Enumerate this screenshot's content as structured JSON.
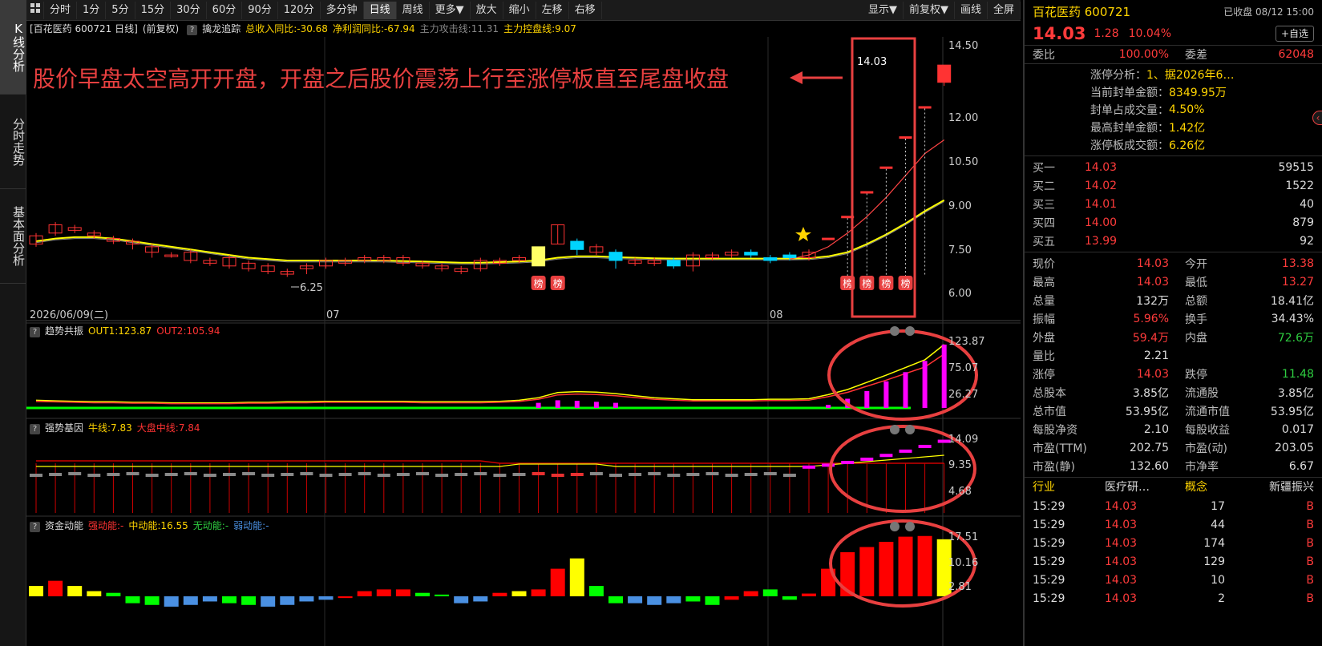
{
  "sidebar": {
    "tabs": [
      {
        "label": "K线分析"
      },
      {
        "label": "分时走势"
      },
      {
        "label": "基本面分析"
      }
    ]
  },
  "toolbar": {
    "left_items": [
      "分时",
      "1分",
      "5分",
      "15分",
      "30分",
      "60分",
      "90分",
      "120分",
      "多分钟",
      "日线",
      "周线",
      "更多▼",
      "放大",
      "缩小",
      "左移",
      "右移"
    ],
    "active": "日线",
    "right_items": [
      "显示▼",
      "前复权▼",
      "画线",
      "全屏"
    ]
  },
  "main_chart": {
    "info": {
      "title": "[百花医药 600721 日线]",
      "adjust": "(前复权)",
      "indicator_name": "擒龙追踪",
      "rev_yoy": "总收入同比:-30.68",
      "profit_yoy": "净利润同比:-67.94",
      "attack_line": "主力攻击线:11.31",
      "control_line": "主力控盘线:9.07"
    },
    "annotation": "股价早盘太空高开开盘，开盘之后股价震荡上行至涨停板直至尾盘收盘",
    "price_labels": [
      "14.50",
      "12.00",
      "10.50",
      "9.00",
      "7.50",
      "6.00"
    ],
    "high_label": "14.03",
    "low_label": "6.25",
    "date_labels": [
      "2026/06/09(二)",
      "07",
      "08"
    ],
    "badge": "榜",
    "colors": {
      "up": "#ff3333",
      "down": "#00d4ff",
      "ma_yellow": "#ffff00",
      "ma_gray": "#888888",
      "ma_red": "#ff4444",
      "highlight": "#e84040"
    }
  },
  "panel_trend": {
    "name": "趋势共振",
    "out1": "OUT1:123.87",
    "out2": "OUT2:105.94",
    "labels": [
      "123.87",
      "75.07",
      "26.27"
    ]
  },
  "panel_strong": {
    "name": "强势基因",
    "bull": "牛线:7.83",
    "market": "大盘中线:7.84",
    "labels": [
      "14.09",
      "9.35",
      "4.68"
    ]
  },
  "panel_fund": {
    "name": "资金动能",
    "strong": "强动能:-",
    "mid": "中动能:16.55",
    "none": "无动能:-",
    "weak": "弱动能:-",
    "labels": [
      "17.51",
      "10.16",
      "2.81"
    ]
  },
  "chart_data": {
    "type": "candlestick",
    "candles": [
      [
        7.5,
        7.8,
        7.4,
        7.9
      ],
      [
        7.9,
        8.2,
        7.8,
        8.3
      ],
      [
        8.0,
        8.1,
        7.9,
        8.2
      ],
      [
        7.8,
        7.9,
        7.7,
        8.0
      ],
      [
        7.6,
        7.7,
        7.5,
        7.8
      ],
      [
        7.5,
        7.6,
        7.3,
        7.7
      ],
      [
        7.2,
        7.4,
        7.0,
        7.5
      ],
      [
        7.1,
        7.1,
        7.0,
        7.2
      ],
      [
        6.9,
        7.2,
        6.8,
        7.3
      ],
      [
        6.8,
        6.9,
        6.7,
        7.0
      ],
      [
        6.7,
        7.0,
        6.6,
        7.1
      ],
      [
        6.6,
        6.8,
        6.5,
        6.9
      ],
      [
        6.5,
        6.7,
        6.4,
        6.8
      ],
      [
        6.4,
        6.5,
        6.3,
        6.6
      ],
      [
        6.6,
        6.7,
        6.4,
        6.8
      ],
      [
        6.7,
        6.9,
        6.6,
        7.0
      ],
      [
        6.8,
        6.9,
        6.7,
        7.0
      ],
      [
        6.9,
        7.0,
        6.8,
        7.1
      ],
      [
        6.9,
        7.0,
        6.8,
        7.1
      ],
      [
        6.8,
        7.0,
        6.7,
        7.1
      ],
      [
        6.7,
        6.8,
        6.6,
        6.9
      ],
      [
        6.6,
        6.7,
        6.5,
        6.8
      ],
      [
        6.5,
        6.6,
        6.4,
        6.7
      ],
      [
        6.6,
        6.9,
        6.5,
        7.0
      ],
      [
        6.8,
        6.9,
        6.7,
        7.0
      ],
      [
        6.9,
        7.0,
        6.8,
        7.1
      ],
      [
        6.7,
        7.4,
        6.7,
        7.4
      ],
      [
        7.5,
        8.2,
        7.5,
        8.2
      ],
      [
        7.6,
        7.3,
        7.1,
        7.7
      ],
      [
        7.2,
        7.4,
        7.1,
        7.5
      ],
      [
        7.2,
        6.9,
        6.6,
        7.3
      ],
      [
        6.8,
        6.9,
        6.7,
        7.0
      ],
      [
        6.8,
        6.9,
        6.7,
        7.0
      ],
      [
        6.9,
        6.7,
        6.6,
        7.0
      ],
      [
        6.7,
        7.1,
        6.5,
        7.2
      ],
      [
        7.0,
        7.1,
        6.9,
        7.2
      ],
      [
        7.1,
        7.2,
        7.0,
        7.3
      ],
      [
        7.2,
        7.1,
        7.0,
        7.3
      ],
      [
        7.0,
        6.9,
        6.8,
        7.1
      ],
      [
        7.1,
        7.0,
        6.9,
        7.2
      ],
      [
        7.0,
        7.2,
        6.9,
        7.3
      ],
      [
        7.7,
        7.7,
        7.7,
        7.7
      ],
      [
        8.5,
        8.5,
        8.5,
        8.5
      ],
      [
        9.4,
        9.4,
        9.4,
        9.4
      ],
      [
        10.3,
        10.3,
        10.3,
        10.3
      ],
      [
        11.4,
        11.4,
        11.4,
        11.4
      ],
      [
        12.5,
        12.5,
        12.5,
        12.5
      ],
      [
        13.4,
        14.03,
        13.27,
        14.03
      ]
    ],
    "ylim": [
      5.7,
      15.0
    ],
    "ma_yellow": [
      7.6,
      7.7,
      7.75,
      7.75,
      7.7,
      7.6,
      7.5,
      7.4,
      7.3,
      7.2,
      7.1,
      7.0,
      6.95,
      6.9,
      6.9,
      6.9,
      6.9,
      6.9,
      6.9,
      6.88,
      6.86,
      6.84,
      6.82,
      6.82,
      6.84,
      6.86,
      6.9,
      7.0,
      7.05,
      7.05,
      7.02,
      7.0,
      6.98,
      6.97,
      6.97,
      6.97,
      6.97,
      6.97,
      6.97,
      6.97,
      6.98,
      7.05,
      7.2,
      7.5,
      7.85,
      8.25,
      8.7,
      9.1
    ],
    "ma_red": [
      null,
      null,
      null,
      null,
      null,
      null,
      null,
      null,
      null,
      null,
      null,
      null,
      null,
      null,
      null,
      null,
      null,
      null,
      null,
      null,
      null,
      null,
      null,
      null,
      null,
      null,
      null,
      null,
      null,
      null,
      null,
      null,
      null,
      null,
      null,
      null,
      null,
      null,
      null,
      6.95,
      7.1,
      7.4,
      7.9,
      8.5,
      9.2,
      10.0,
      10.8,
      11.3
    ],
    "trend_out1": [
      15,
      14,
      13,
      12,
      12,
      11,
      11,
      10,
      10,
      10,
      10,
      11,
      11,
      12,
      12,
      13,
      13,
      13,
      13,
      13,
      12,
      12,
      12,
      12,
      13,
      15,
      20,
      30,
      32,
      31,
      28,
      24,
      20,
      18,
      16,
      16,
      16,
      16,
      17,
      17,
      18,
      26,
      36,
      50,
      64,
      79,
      94,
      123.87
    ],
    "trend_bars": [
      0,
      0,
      0,
      0,
      0,
      0,
      0,
      0,
      0,
      0,
      0,
      0,
      0,
      0,
      0,
      0,
      0,
      0,
      0,
      0,
      0,
      0,
      0,
      0,
      0,
      0,
      10,
      15,
      14,
      12,
      10,
      0,
      0,
      0,
      0,
      0,
      0,
      0,
      0,
      0,
      0,
      6,
      18,
      33,
      52,
      70,
      92,
      123.87
    ],
    "fund_bars": [
      3,
      4.5,
      3,
      1.5,
      1,
      -2,
      -2.5,
      -3,
      -2.5,
      -1.5,
      -2,
      -2.5,
      -3,
      -2.5,
      -1.5,
      -1,
      -0.5,
      1.5,
      2,
      2,
      1,
      0.5,
      -2,
      -1.5,
      1,
      1.5,
      2,
      8,
      11,
      3,
      -2,
      -2,
      -2.5,
      -2,
      -1.5,
      -2.5,
      -1,
      1.5,
      2,
      -1,
      0.8,
      8,
      12.8,
      14.3,
      15.8,
      17.3,
      17.5,
      16.55
    ],
    "fund_colors": [
      "y",
      "r",
      "y",
      "y",
      "g",
      "g",
      "g",
      "b",
      "b",
      "b",
      "g",
      "g",
      "b",
      "b",
      "b",
      "b",
      "r",
      "r",
      "r",
      "r",
      "g",
      "g",
      "b",
      "b",
      "r",
      "y",
      "r",
      "r",
      "y",
      "g",
      "g",
      "b",
      "b",
      "b",
      "g",
      "g",
      "r",
      "r",
      "g",
      "g",
      "r",
      "r",
      "r",
      "r",
      "r",
      "r",
      "r",
      "y"
    ]
  },
  "right_panel": {
    "name": "百花医药 600721",
    "status": "已收盘 08/12 15:00",
    "price": "14.03",
    "change": "1.28",
    "pct": "10.04%",
    "watch": "+自选",
    "wb_label": "委比",
    "wb_val": "100.00%",
    "wc_label": "委差",
    "wc_val": "62048",
    "limit_info": [
      {
        "label": "涨停分析：",
        "val": "1、据2026年6…"
      },
      {
        "label": "当前封单金额：",
        "val": "8349.95万"
      },
      {
        "label": "封单占成交量：",
        "val": "4.50%"
      },
      {
        "label": "最高封单金额：",
        "val": "1.42亿"
      },
      {
        "label": "涨停板成交额：",
        "val": "6.26亿"
      }
    ],
    "bids": [
      {
        "label": "买一",
        "price": "14.03",
        "vol": "59515"
      },
      {
        "label": "买二",
        "price": "14.02",
        "vol": "1522"
      },
      {
        "label": "买三",
        "price": "14.01",
        "vol": "40"
      },
      {
        "label": "买四",
        "price": "14.00",
        "vol": "879"
      },
      {
        "label": "买五",
        "price": "13.99",
        "vol": "92"
      }
    ],
    "quote": [
      {
        "l1": "现价",
        "v1": "14.03",
        "c1": "red",
        "l2": "今开",
        "v2": "13.38",
        "c2": "red"
      },
      {
        "l1": "最高",
        "v1": "14.03",
        "c1": "red",
        "l2": "最低",
        "v2": "13.27",
        "c2": "red"
      },
      {
        "l1": "总量",
        "v1": "132万",
        "c1": "white",
        "l2": "总额",
        "v2": "18.41亿",
        "c2": "white"
      },
      {
        "l1": "振幅",
        "v1": "5.96%",
        "c1": "red",
        "l2": "换手",
        "v2": "34.43%",
        "c2": "white"
      },
      {
        "l1": "外盘",
        "v1": "59.4万",
        "c1": "red",
        "l2": "内盘",
        "v2": "72.6万",
        "c2": "green"
      },
      {
        "l1": "量比",
        "v1": "2.21",
        "c1": "white",
        "l2": "",
        "v2": "",
        "c2": "white"
      },
      {
        "l1": "涨停",
        "v1": "14.03",
        "c1": "red",
        "l2": "跌停",
        "v2": "11.48",
        "c2": "green"
      },
      {
        "l1": "总股本",
        "v1": "3.85亿",
        "c1": "white",
        "l2": "流通股",
        "v2": "3.85亿",
        "c2": "white"
      },
      {
        "l1": "总市值",
        "v1": "53.95亿",
        "c1": "white",
        "l2": "流通市值",
        "v2": "53.95亿",
        "c2": "white"
      },
      {
        "l1": "每股净资",
        "v1": "2.10",
        "c1": "white",
        "l2": "每股收益",
        "v2": "0.017",
        "c2": "white"
      },
      {
        "l1": "市盈(TTM)",
        "v1": "202.75",
        "c1": "white",
        "l2": "市盈(动)",
        "v2": "203.05",
        "c2": "white"
      },
      {
        "l1": "市盈(静)",
        "v1": "132.60",
        "c1": "white",
        "l2": "市净率",
        "v2": "6.67",
        "c2": "white"
      }
    ],
    "industry": {
      "l1": "行业",
      "v1": "医疗研…",
      "l2": "概念",
      "v2": "新疆振兴"
    },
    "ticks": [
      {
        "t": "15:29",
        "p": "14.03",
        "v": "17",
        "s": "B"
      },
      {
        "t": "15:29",
        "p": "14.03",
        "v": "44",
        "s": "B"
      },
      {
        "t": "15:29",
        "p": "14.03",
        "v": "174",
        "s": "B"
      },
      {
        "t": "15:29",
        "p": "14.03",
        "v": "129",
        "s": "B"
      },
      {
        "t": "15:29",
        "p": "14.03",
        "v": "10",
        "s": "B"
      },
      {
        "t": "15:29",
        "p": "14.03",
        "v": "2",
        "s": "B"
      }
    ]
  }
}
